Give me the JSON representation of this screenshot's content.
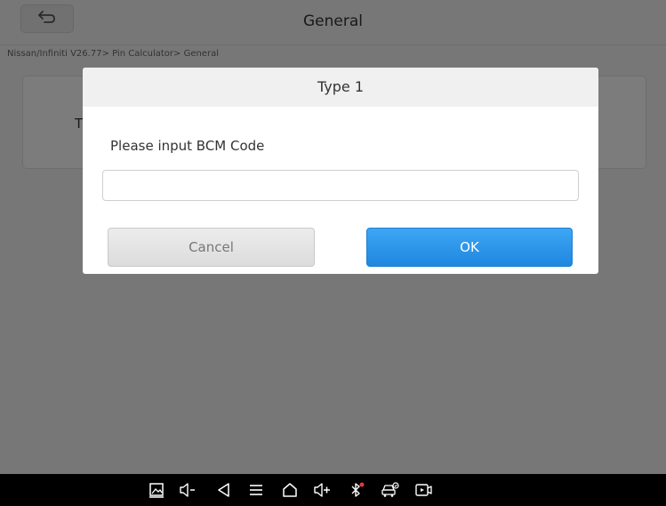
{
  "header": {
    "title": "General",
    "back_icon": "back-arrow-icon"
  },
  "breadcrumb": "Nissan/Infiniti V26.77> Pin Calculator> General",
  "card": {
    "text": "T"
  },
  "dialog": {
    "title": "Type 1",
    "label": "Please input BCM Code",
    "input_value": "",
    "cancel_label": "Cancel",
    "ok_label": "OK"
  },
  "navbar": {
    "icons": [
      "screenshot-icon",
      "volume-down-icon",
      "back-icon",
      "menu-icon",
      "home-icon",
      "volume-up-icon",
      "bluetooth-icon",
      "vehicle-diagnostics-icon",
      "screen-record-icon"
    ]
  },
  "colors": {
    "accent": "#2b95ea",
    "overlay": "rgba(0,0,0,0.5)",
    "bluetooth_dot": "#e53935"
  }
}
